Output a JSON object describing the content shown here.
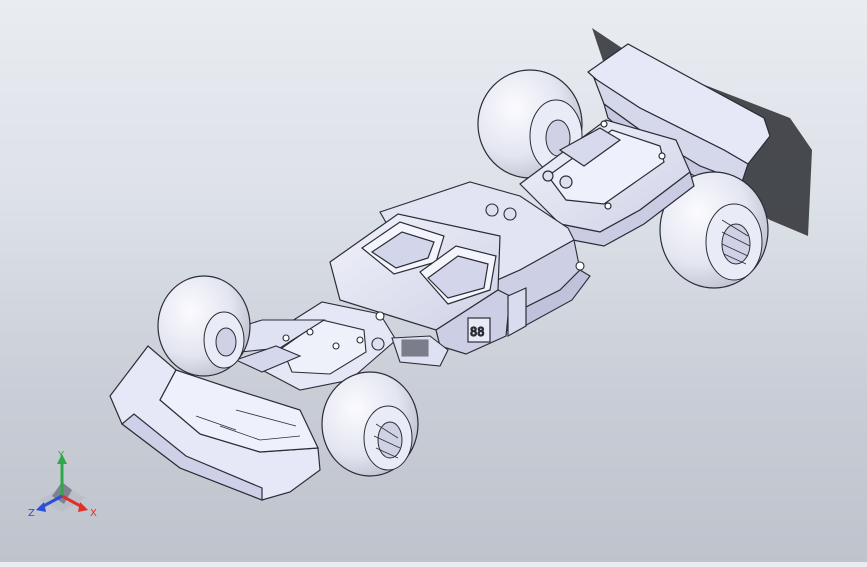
{
  "viewport": {
    "background_top": "#e9ecf1",
    "background_bottom": "#bfc3cc",
    "model_fill": "#e4e6f7",
    "model_stroke": "#2b2d36",
    "tire_fill": "#eceef6"
  },
  "triad": {
    "x_label": "X",
    "y_label": "Y",
    "z_label": "Z",
    "x_color": "#e0302a",
    "y_color": "#2fa84a",
    "z_color": "#2d4fd8"
  }
}
